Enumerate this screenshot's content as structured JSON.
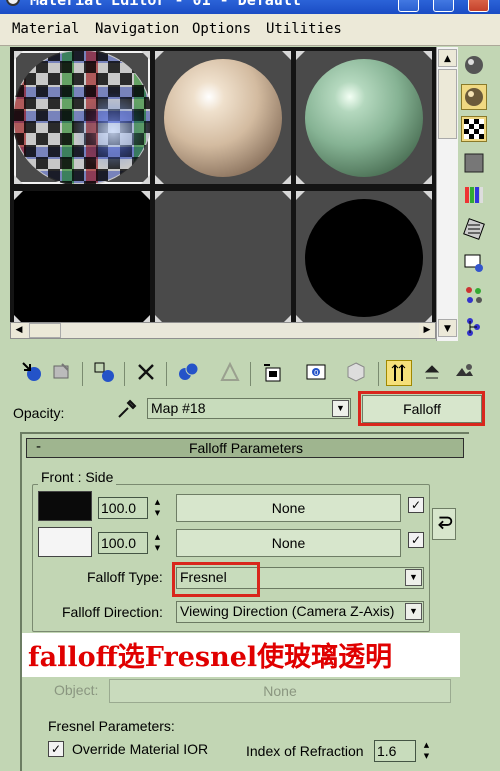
{
  "window": {
    "title": "Material Editor - 01 - Default"
  },
  "menu": [
    "Material",
    "Navigation",
    "Options",
    "Utilities"
  ],
  "slots": [
    {
      "name": "checker",
      "selected": true
    },
    {
      "name": "beige"
    },
    {
      "name": "green"
    },
    {
      "name": "black"
    },
    {
      "name": "empty"
    },
    {
      "name": "black-sphere"
    }
  ],
  "right_toolbar": [
    "sample-type-icon",
    "backlight-icon",
    "background-icon",
    "uv-tiling-icon",
    "video-color-check-icon",
    "make-preview-icon",
    "options-icon",
    "select-by-material-icon",
    "material-navigator-icon"
  ],
  "bottom_toolbar": [
    "get-material-icon",
    "put-to-scene-icon",
    "assign-to-selection-icon",
    "reset-map-icon",
    "make-unique-icon",
    "put-to-library-icon",
    "material-effects-channel-icon",
    "show-map-icon",
    "show-end-result-icon",
    "go-to-parent-icon",
    "go-forward-icon"
  ],
  "opacity": {
    "label": "Opacity:",
    "map_value": "Map #18",
    "type_button": "Falloff"
  },
  "rollout": {
    "title": "Falloff Parameters",
    "collapse_sign": "-",
    "group_label": "Front : Side",
    "row1": {
      "color": "#0a0a0a",
      "amount": "100.0",
      "map": "None",
      "checked": true
    },
    "row2": {
      "color": "#f5f5f5",
      "amount": "100.0",
      "map": "None",
      "checked": true
    },
    "falloff_type_label": "Falloff Type:",
    "falloff_type_value": "Fresnel",
    "falloff_direction_label": "Falloff Direction:",
    "falloff_direction_value": "Viewing Direction (Camera Z-Axis)",
    "object_label": "Object:",
    "object_value": "None",
    "fresnel_label": "Fresnel Parameters:",
    "override_label": "Override Material IOR",
    "override_checked": true,
    "ior_label": "Index of Refraction",
    "ior_value": "1.6"
  },
  "annotation": "falloff选Fresnel使玻璃透明",
  "colors": {
    "highlight": "#d9261c",
    "panel_bg": "#c2d6b4",
    "annotation_text": "#e00000"
  }
}
